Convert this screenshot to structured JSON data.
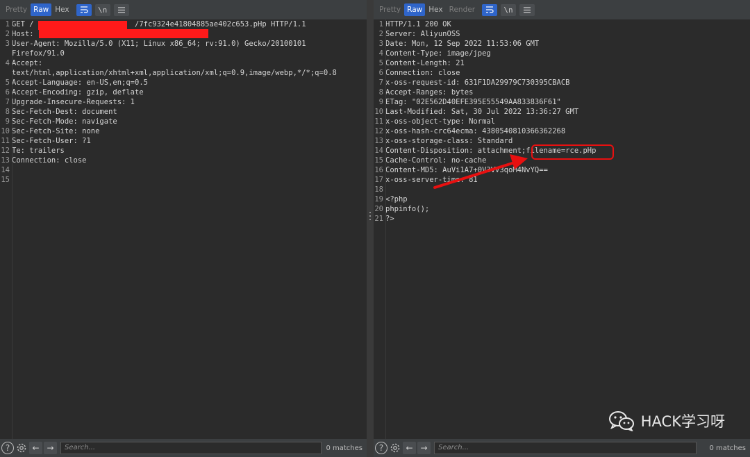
{
  "left": {
    "toolbar": {
      "pretty": "Pretty",
      "raw": "Raw",
      "hex": "Hex",
      "newline": "\\n"
    },
    "lines": [
      {
        "n": "1",
        "t": "GET /                       /7fc9324e41804885ae402c653.pHp HTTP/1.1"
      },
      {
        "n": "2",
        "t": "Host:"
      },
      {
        "n": "3",
        "t": "User-Agent: Mozilla/5.0 (X11; Linux x86_64; rv:91.0) Gecko/20100101"
      },
      {
        "n": "",
        "t": "Firefox/91.0"
      },
      {
        "n": "4",
        "t": "Accept:"
      },
      {
        "n": "",
        "t": "text/html,application/xhtml+xml,application/xml;q=0.9,image/webp,*/*;q=0.8"
      },
      {
        "n": "5",
        "t": "Accept-Language: en-US,en;q=0.5"
      },
      {
        "n": "6",
        "t": "Accept-Encoding: gzip, deflate"
      },
      {
        "n": "7",
        "t": "Upgrade-Insecure-Requests: 1"
      },
      {
        "n": "8",
        "t": "Sec-Fetch-Dest: document"
      },
      {
        "n": "9",
        "t": "Sec-Fetch-Mode: navigate"
      },
      {
        "n": "10",
        "t": "Sec-Fetch-Site: none"
      },
      {
        "n": "11",
        "t": "Sec-Fetch-User: ?1"
      },
      {
        "n": "12",
        "t": "Te: trailers"
      },
      {
        "n": "13",
        "t": "Connection: close"
      },
      {
        "n": "14",
        "t": ""
      },
      {
        "n": "15",
        "t": ""
      }
    ],
    "footer": {
      "search_placeholder": "Search...",
      "matches": "0 matches"
    }
  },
  "right": {
    "toolbar": {
      "pretty": "Pretty",
      "raw": "Raw",
      "hex": "Hex",
      "render": "Render",
      "newline": "\\n"
    },
    "lines": [
      {
        "n": "1",
        "t": "HTTP/1.1 200 OK"
      },
      {
        "n": "2",
        "t": "Server: AliyunOSS"
      },
      {
        "n": "3",
        "t": "Date: Mon, 12 Sep 2022 11:53:06 GMT"
      },
      {
        "n": "4",
        "t": "Content-Type: image/jpeg"
      },
      {
        "n": "5",
        "t": "Content-Length: 21"
      },
      {
        "n": "6",
        "t": "Connection: close"
      },
      {
        "n": "7",
        "t": "x-oss-request-id: 631F1DA29979C730395CBACB"
      },
      {
        "n": "8",
        "t": "Accept-Ranges: bytes"
      },
      {
        "n": "9",
        "t": "ETag: \"02E562D40EFE395E55549AA833836F61\""
      },
      {
        "n": "10",
        "t": "Last-Modified: Sat, 30 Jul 2022 13:36:27 GMT"
      },
      {
        "n": "11",
        "t": "x-oss-object-type: Normal"
      },
      {
        "n": "12",
        "t": "x-oss-hash-crc64ecma: 4380540810366362268"
      },
      {
        "n": "13",
        "t": "x-oss-storage-class: Standard"
      },
      {
        "n": "14",
        "t": "Content-Disposition: attachment;filename=rce.pHp"
      },
      {
        "n": "15",
        "t": "Cache-Control: no-cache"
      },
      {
        "n": "16",
        "t": "Content-MD5: AuVi1A7+0V3VV3qoM4NvYQ=="
      },
      {
        "n": "17",
        "t": "x-oss-server-time: 81"
      },
      {
        "n": "18",
        "t": ""
      },
      {
        "n": "19",
        "t": "<?php"
      },
      {
        "n": "20",
        "t": "phpinfo();"
      },
      {
        "n": "21",
        "t": "?>"
      }
    ],
    "footer": {
      "search_placeholder": "Search...",
      "matches": "0 matches"
    }
  },
  "watermark": {
    "text": "HACK学习呀"
  },
  "colors": {
    "accent": "#2f65ca",
    "highlight": "#e81010",
    "redaction": "#ff1a1a"
  }
}
